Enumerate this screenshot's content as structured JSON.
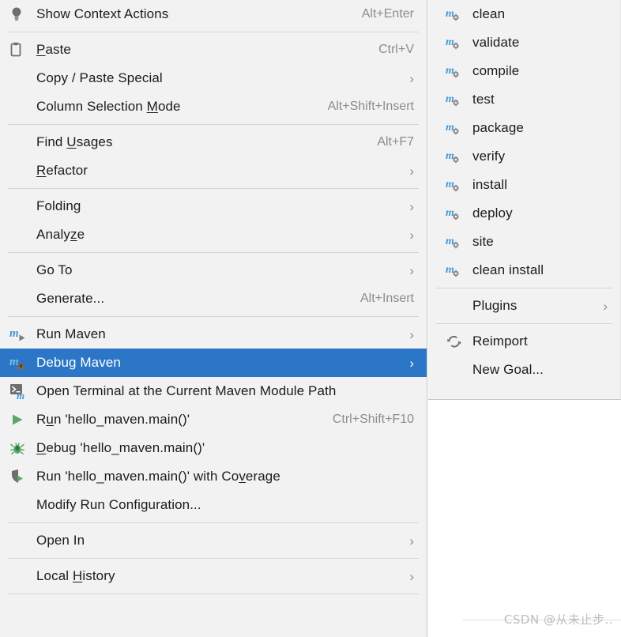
{
  "menu": {
    "name": "editor-context-menu",
    "groups": [
      {
        "items": [
          {
            "label": "Show Context Actions",
            "mnemonic": "",
            "shortcut": "Alt+Enter",
            "icon": "lightbulb-icon",
            "submenu": false,
            "selected": false
          }
        ]
      },
      {
        "items": [
          {
            "label": "Paste",
            "mnemonic": "P",
            "shortcut": "Ctrl+V",
            "icon": "clipboard-icon",
            "submenu": false,
            "selected": false
          },
          {
            "label": "Copy / Paste Special",
            "mnemonic": "",
            "shortcut": "",
            "icon": "",
            "submenu": true,
            "selected": false
          },
          {
            "label": "Column Selection Mode",
            "mnemonic": "M",
            "shortcut": "Alt+Shift+Insert",
            "icon": "",
            "submenu": false,
            "selected": false
          }
        ]
      },
      {
        "items": [
          {
            "label": "Find Usages",
            "mnemonic": "U",
            "shortcut": "Alt+F7",
            "icon": "",
            "submenu": false,
            "selected": false
          },
          {
            "label": "Refactor",
            "mnemonic": "R",
            "shortcut": "",
            "icon": "",
            "submenu": true,
            "selected": false
          }
        ]
      },
      {
        "items": [
          {
            "label": "Folding",
            "mnemonic": "",
            "shortcut": "",
            "icon": "",
            "submenu": true,
            "selected": false
          },
          {
            "label": "Analyze",
            "mnemonic": "z",
            "shortcut": "",
            "icon": "",
            "submenu": true,
            "selected": false
          }
        ]
      },
      {
        "items": [
          {
            "label": "Go To",
            "mnemonic": "",
            "shortcut": "",
            "icon": "",
            "submenu": true,
            "selected": false
          },
          {
            "label": "Generate...",
            "mnemonic": "",
            "shortcut": "Alt+Insert",
            "icon": "",
            "submenu": false,
            "selected": false
          }
        ]
      },
      {
        "items": [
          {
            "label": "Run Maven",
            "mnemonic": "",
            "shortcut": "",
            "icon": "maven-run-icon",
            "submenu": true,
            "selected": false
          },
          {
            "label": "Debug Maven",
            "mnemonic": "",
            "shortcut": "",
            "icon": "maven-debug-icon",
            "submenu": true,
            "selected": true
          },
          {
            "label": "Open Terminal at the Current Maven Module Path",
            "mnemonic": "",
            "shortcut": "",
            "icon": "maven-terminal-icon",
            "submenu": false,
            "selected": false
          },
          {
            "label": "Run 'hello_maven.main()'",
            "mnemonic": "u",
            "shortcut": "Ctrl+Shift+F10",
            "icon": "run-icon",
            "submenu": false,
            "selected": false
          },
          {
            "label": "Debug 'hello_maven.main()'",
            "mnemonic": "D",
            "shortcut": "",
            "icon": "debug-icon",
            "submenu": false,
            "selected": false
          },
          {
            "label": "Run 'hello_maven.main()' with Coverage",
            "mnemonic": "v",
            "shortcut": "",
            "icon": "coverage-icon",
            "submenu": false,
            "selected": false
          },
          {
            "label": "Modify Run Configuration...",
            "mnemonic": "",
            "shortcut": "",
            "icon": "",
            "submenu": false,
            "selected": false
          }
        ]
      },
      {
        "items": [
          {
            "label": "Open In",
            "mnemonic": "",
            "shortcut": "",
            "icon": "",
            "submenu": true,
            "selected": false
          }
        ]
      },
      {
        "items": [
          {
            "label": "Local History",
            "mnemonic": "H",
            "shortcut": "",
            "icon": "",
            "submenu": true,
            "selected": false
          }
        ]
      }
    ]
  },
  "submenu": {
    "name": "debug-maven-submenu",
    "groups": [
      {
        "items": [
          {
            "label": "clean",
            "icon": "maven-goal-icon",
            "submenu": false,
            "indent": false
          },
          {
            "label": "validate",
            "icon": "maven-goal-icon",
            "submenu": false,
            "indent": false
          },
          {
            "label": "compile",
            "icon": "maven-goal-icon",
            "submenu": false,
            "indent": false
          },
          {
            "label": "test",
            "icon": "maven-goal-icon",
            "submenu": false,
            "indent": false
          },
          {
            "label": "package",
            "icon": "maven-goal-icon",
            "submenu": false,
            "indent": false
          },
          {
            "label": "verify",
            "icon": "maven-goal-icon",
            "submenu": false,
            "indent": false
          },
          {
            "label": "install",
            "icon": "maven-goal-icon",
            "submenu": false,
            "indent": false
          },
          {
            "label": "deploy",
            "icon": "maven-goal-icon",
            "submenu": false,
            "indent": false
          },
          {
            "label": "site",
            "icon": "maven-goal-icon",
            "submenu": false,
            "indent": false
          },
          {
            "label": "clean install",
            "icon": "maven-goal-icon",
            "submenu": false,
            "indent": false
          }
        ]
      },
      {
        "items": [
          {
            "label": "Plugins",
            "icon": "",
            "submenu": true,
            "indent": true
          }
        ]
      },
      {
        "items": [
          {
            "label": "Reimport",
            "icon": "refresh-icon",
            "submenu": false,
            "indent": false
          },
          {
            "label": "New Goal...",
            "icon": "",
            "submenu": false,
            "indent": true
          }
        ]
      }
    ]
  },
  "watermark": {
    "text": "CSDN @从未止步.."
  },
  "colors": {
    "menu_bg": "#f2f2f2",
    "selection_blue": "#2b76c6",
    "maven_blue": "#3d9ada",
    "run_green": "#59a869",
    "icon_gray": "#6e6e6e",
    "shortcut_gray": "#8c8c8c",
    "separator": "#d6d6d6"
  }
}
